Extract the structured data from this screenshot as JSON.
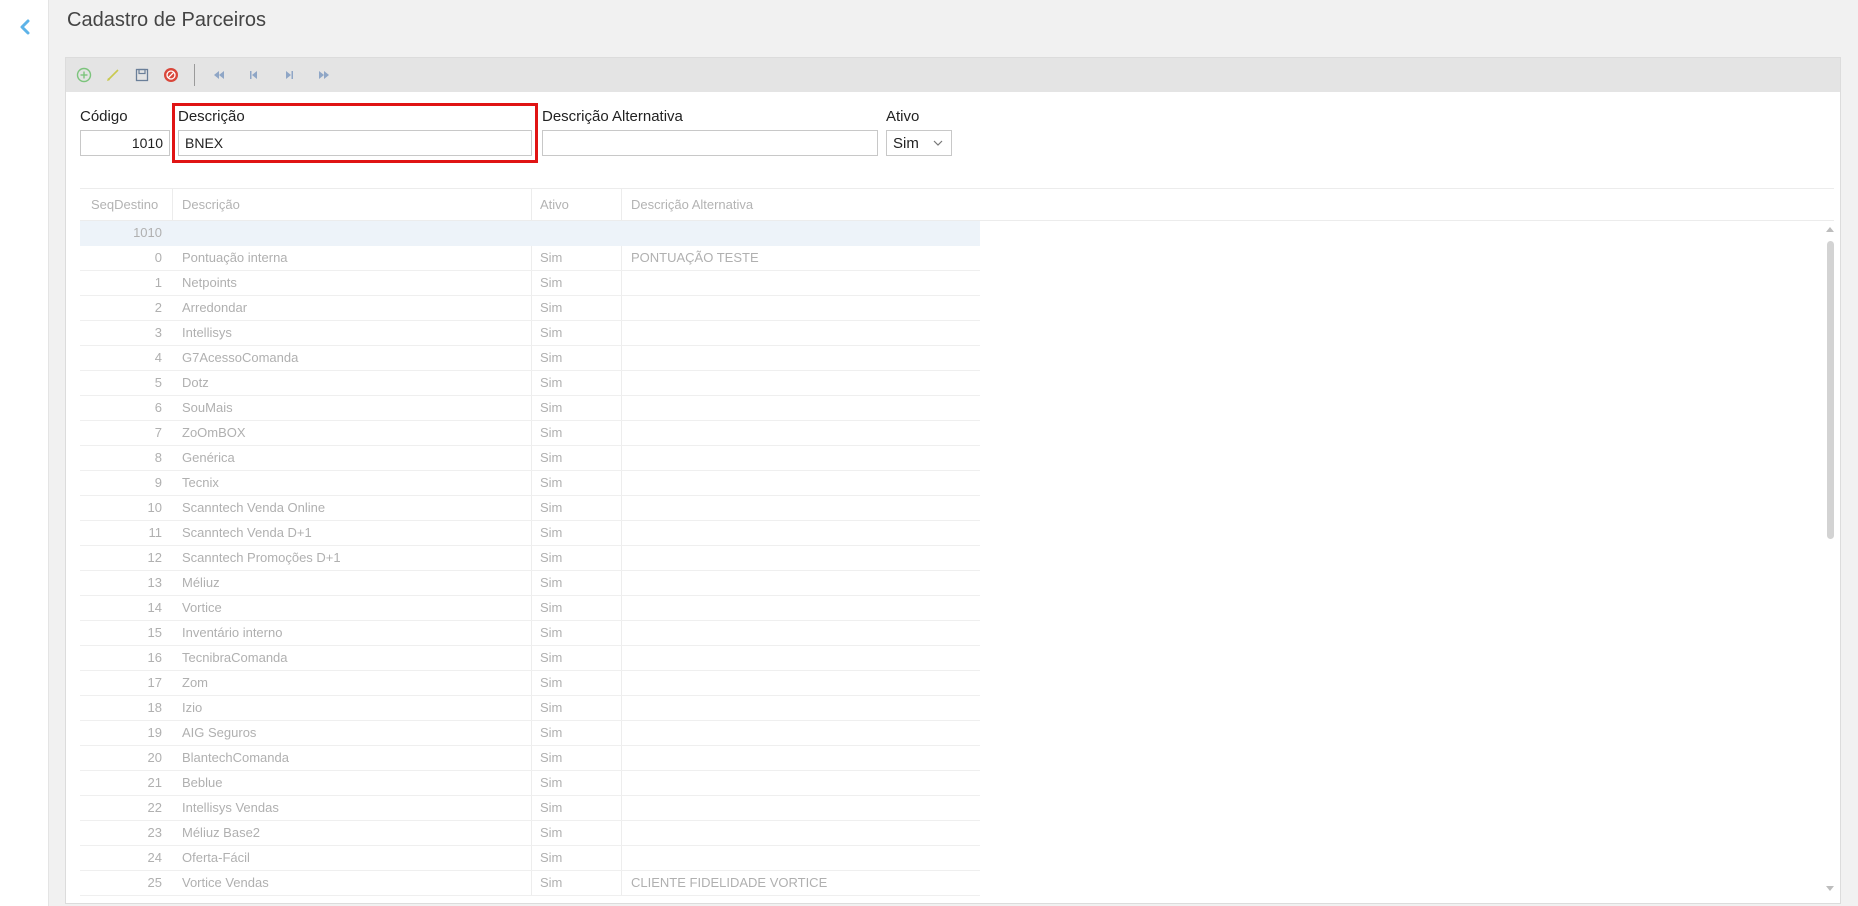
{
  "page": {
    "title": "Cadastro de Parceiros"
  },
  "toolbar": {
    "buttons": [
      "add-icon",
      "edit-icon",
      "save-icon",
      "cancel-icon"
    ],
    "nav": [
      "first-record-icon",
      "previous-record-icon",
      "next-record-icon",
      "last-record-icon"
    ]
  },
  "form": {
    "codigo_label": "Código",
    "codigo_value": "1010",
    "descricao_label": "Descrição",
    "descricao_value": "BNEX",
    "desc_alt_label": "Descrição Alternativa",
    "desc_alt_value": "",
    "ativo_label": "Ativo",
    "ativo_value": "Sim"
  },
  "grid": {
    "columns": [
      "SeqDestino",
      "Descrição",
      "Ativo",
      "Descrição Alternativa"
    ],
    "rows": [
      [
        "1010",
        "",
        "",
        ""
      ],
      [
        "0",
        "Pontuação interna",
        "Sim",
        "PONTUAÇÃO TESTE"
      ],
      [
        "1",
        "Netpoints",
        "Sim",
        ""
      ],
      [
        "2",
        "Arredondar",
        "Sim",
        ""
      ],
      [
        "3",
        "Intellisys",
        "Sim",
        ""
      ],
      [
        "4",
        "G7AcessoComanda",
        "Sim",
        ""
      ],
      [
        "5",
        "Dotz",
        "Sim",
        ""
      ],
      [
        "6",
        "SouMais",
        "Sim",
        ""
      ],
      [
        "7",
        "ZoOmBOX",
        "Sim",
        ""
      ],
      [
        "8",
        "Genérica",
        "Sim",
        ""
      ],
      [
        "9",
        "Tecnix",
        "Sim",
        ""
      ],
      [
        "10",
        "Scanntech Venda Online",
        "Sim",
        ""
      ],
      [
        "11",
        "Scanntech Venda D+1",
        "Sim",
        ""
      ],
      [
        "12",
        "Scanntech Promoções D+1",
        "Sim",
        ""
      ],
      [
        "13",
        "Méliuz",
        "Sim",
        ""
      ],
      [
        "14",
        "Vortice",
        "Sim",
        ""
      ],
      [
        "15",
        "Inventário interno",
        "Sim",
        ""
      ],
      [
        "16",
        "TecnibraComanda",
        "Sim",
        ""
      ],
      [
        "17",
        "Zom",
        "Sim",
        ""
      ],
      [
        "18",
        "Izio",
        "Sim",
        ""
      ],
      [
        "19",
        "AIG Seguros",
        "Sim",
        ""
      ],
      [
        "20",
        "BlantechComanda",
        "Sim",
        ""
      ],
      [
        "21",
        "Beblue",
        "Sim",
        ""
      ],
      [
        "22",
        "Intellisys Vendas",
        "Sim",
        ""
      ],
      [
        "23",
        "Méliuz Base2",
        "Sim",
        ""
      ],
      [
        "24",
        "Oferta-Fácil",
        "Sim",
        ""
      ],
      [
        "25",
        "Vortice Vendas",
        "Sim",
        "CLIENTE FIDELIDADE VORTICE"
      ]
    ]
  },
  "colors": {
    "highlight": "#e01414",
    "accent": "#4aa3df",
    "selected_row": "#edf3f9"
  }
}
